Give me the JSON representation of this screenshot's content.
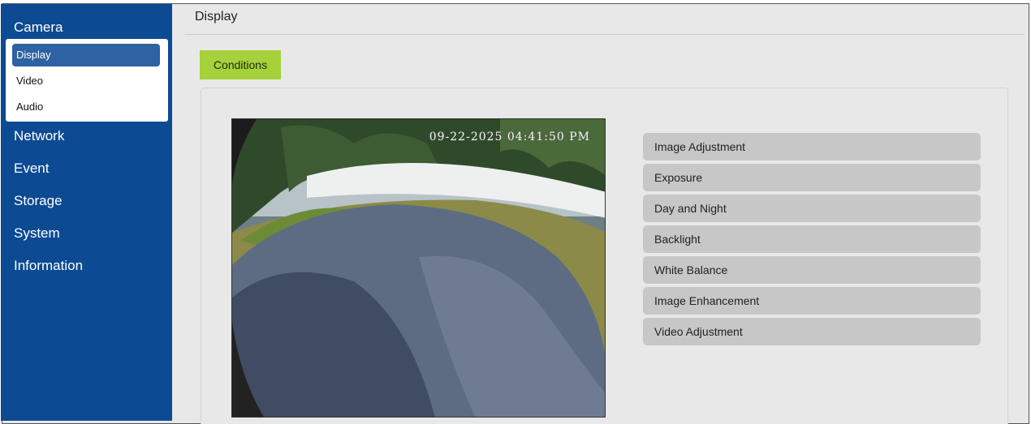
{
  "sidebar": {
    "sections": [
      {
        "label": "Camera"
      },
      {
        "label": "Network"
      },
      {
        "label": "Event"
      },
      {
        "label": "Storage"
      },
      {
        "label": "System"
      },
      {
        "label": "Information"
      }
    ],
    "camera_submenu": [
      {
        "label": "Display",
        "active": true
      },
      {
        "label": "Video",
        "active": false
      },
      {
        "label": "Audio",
        "active": false
      }
    ]
  },
  "header": {
    "title": "Display"
  },
  "tabs": [
    {
      "label": "Conditions",
      "active": true
    }
  ],
  "preview": {
    "timestamp": "09-22-2025 04:41:50 PM"
  },
  "settings_menu": [
    {
      "label": "Image Adjustment"
    },
    {
      "label": "Exposure"
    },
    {
      "label": "Day and Night"
    },
    {
      "label": "Backlight"
    },
    {
      "label": "White Balance"
    },
    {
      "label": "Image Enhancement"
    },
    {
      "label": "Video Adjustment"
    }
  ],
  "colors": {
    "sidebar_bg": "#0d4a94",
    "active_sub": "#2d62a3",
    "tab_accent": "#a5d13a",
    "menu_button": "#c7c7c7"
  }
}
